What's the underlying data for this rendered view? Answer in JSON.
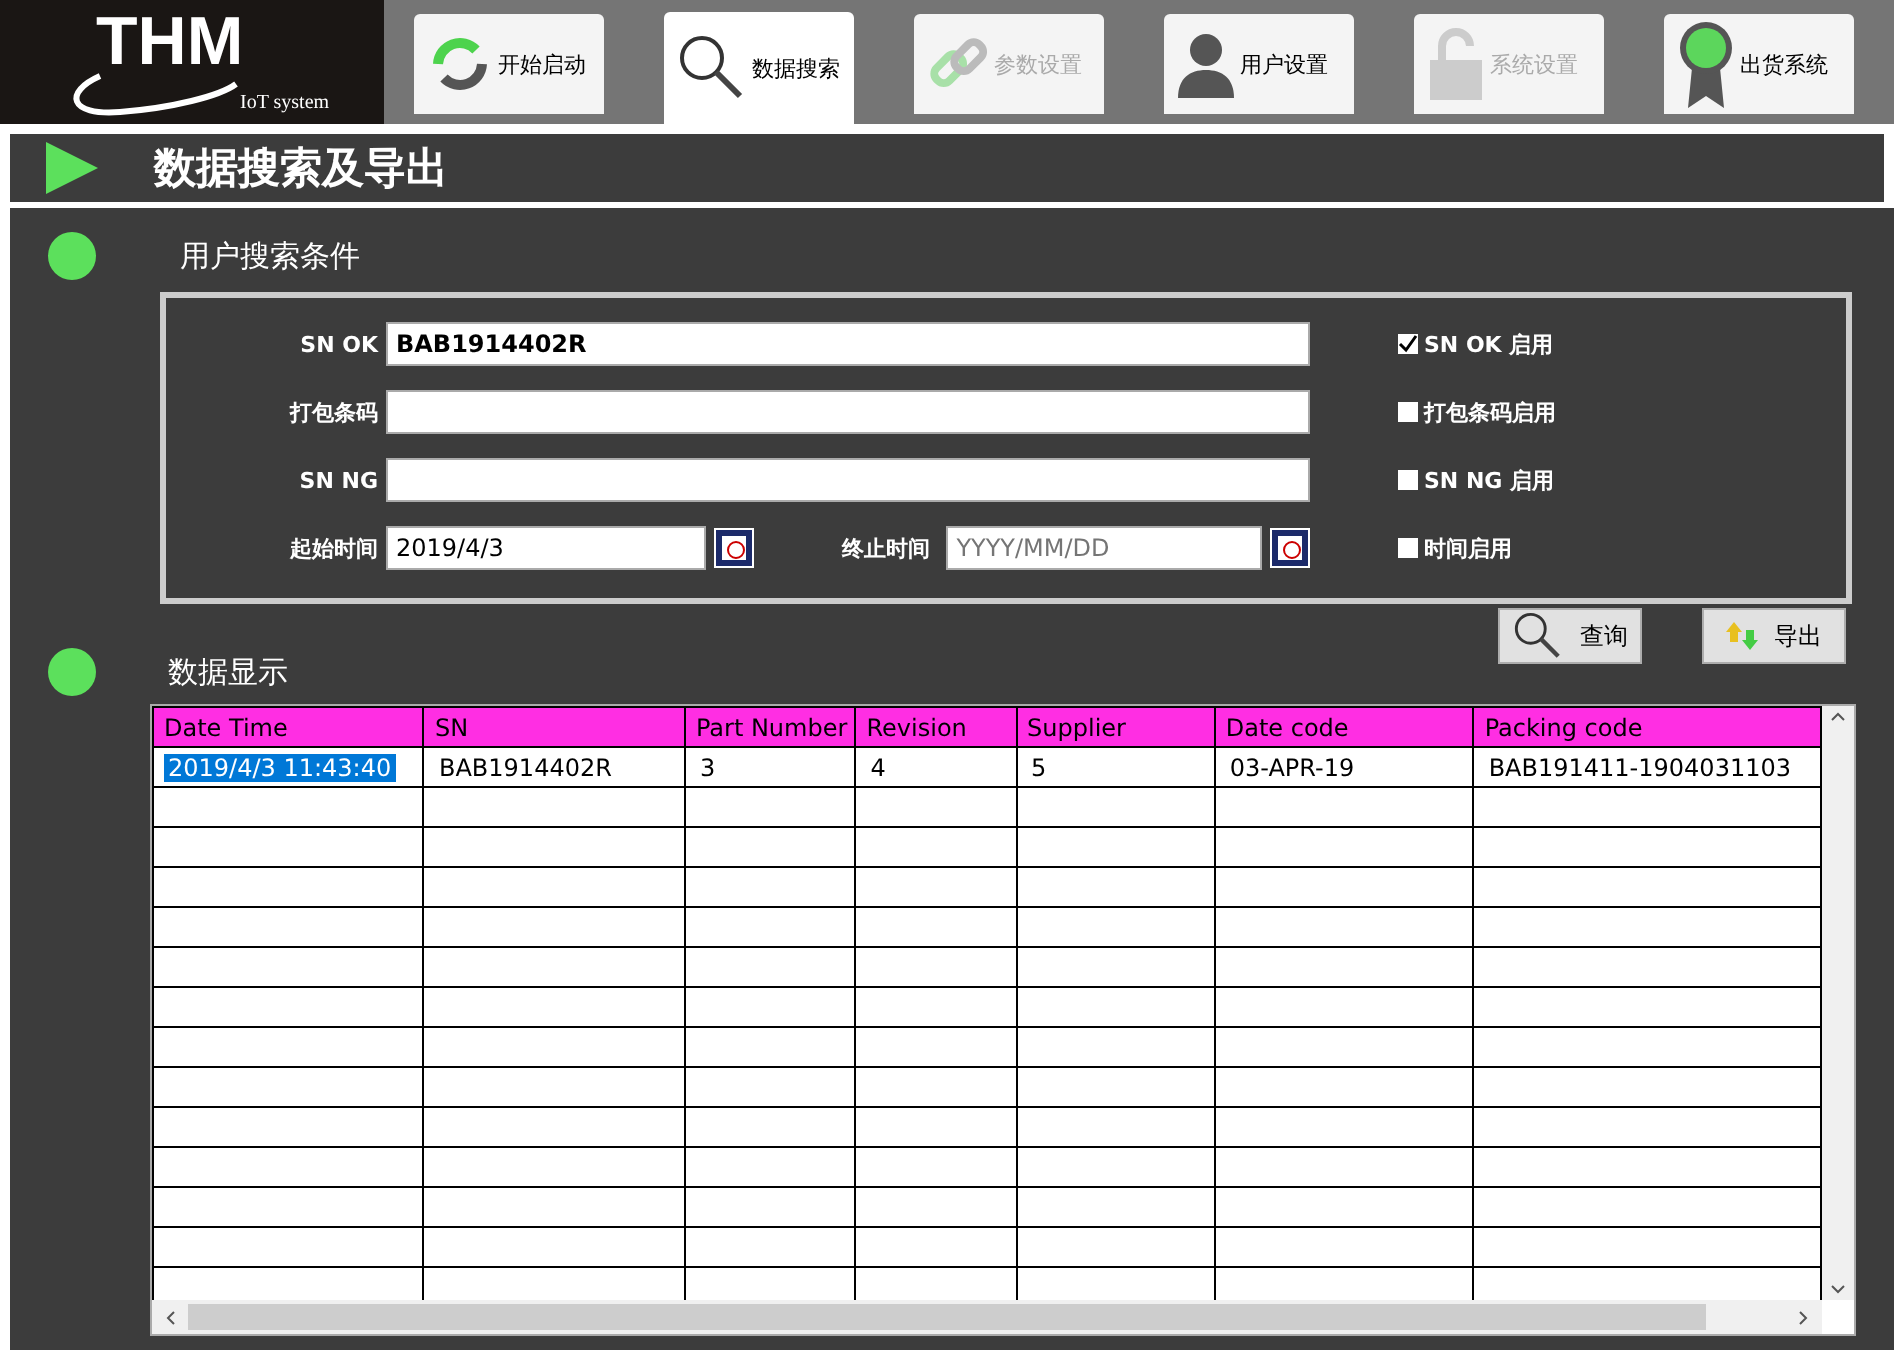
{
  "logo": {
    "brand": "THM",
    "tagline": "IoT system"
  },
  "nav_tabs": [
    {
      "label": "开始启动",
      "selected": false,
      "disabled": false
    },
    {
      "label": "数据搜索",
      "selected": true,
      "disabled": false
    },
    {
      "label": "参数设置",
      "selected": false,
      "disabled": true
    },
    {
      "label": "用户设置",
      "selected": false,
      "disabled": false
    },
    {
      "label": "系统设置",
      "selected": false,
      "disabled": true
    },
    {
      "label": "出货系统",
      "selected": false,
      "disabled": false
    }
  ],
  "page_title": "数据搜索及导出",
  "search_section": {
    "title": "用户搜索条件",
    "fields": [
      {
        "label": "SN OK",
        "value": "BAB1914402R"
      },
      {
        "label": "打包条码"
      },
      {
        "label": "SN NG"
      }
    ],
    "start_time": {
      "label": "起始时间",
      "value": "2019/4/3"
    },
    "end_time": {
      "label": "终止时间",
      "placeholder": "YYYY/MM/DD"
    },
    "checkboxes": [
      {
        "label": "SN OK 启用",
        "checked": true
      },
      {
        "label": "打包条码启用",
        "checked": false
      },
      {
        "label": "SN NG 启用",
        "checked": false
      },
      {
        "label": "时间启用",
        "checked": false
      }
    ]
  },
  "data_section": {
    "title": "数据显示",
    "buttons": [
      {
        "label": "查询"
      },
      {
        "label": "导出"
      }
    ],
    "table": {
      "columns": [
        "Date Time",
        "SN",
        "Part Number",
        "Revision",
        "Supplier",
        "Date code",
        "Packing code"
      ],
      "rows": [
        {
          "selected": true,
          "cells": [
            "2019/4/3 11:43:40",
            "BAB1914402R",
            "3",
            "4",
            "5",
            "03-APR-19",
            "BAB191411-1904031103"
          ]
        }
      ]
    }
  }
}
